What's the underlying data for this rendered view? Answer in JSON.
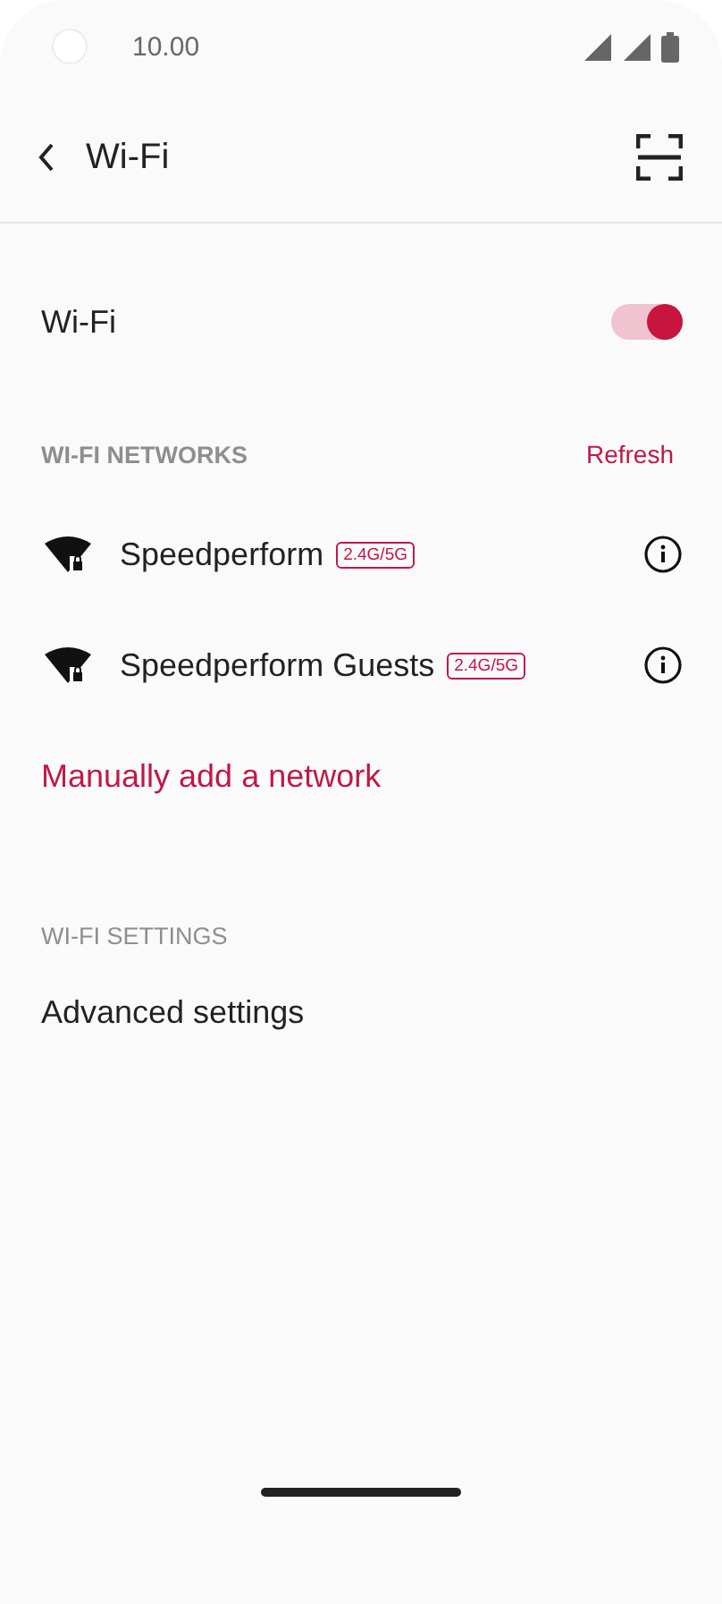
{
  "status_bar": {
    "time": "10.00"
  },
  "header": {
    "title": "Wi-Fi"
  },
  "wifi_toggle": {
    "label": "Wi-Fi",
    "on": true
  },
  "networks_section": {
    "title": "WI-FI NETWORKS",
    "action": "Refresh"
  },
  "networks": [
    {
      "name": "Speedperform",
      "band": "2.4G/5G",
      "secured": true
    },
    {
      "name": "Speedperform Guests",
      "band": "2.4G/5G",
      "secured": true
    }
  ],
  "add_network": "Manually add a network",
  "settings_section": {
    "title": "WI-FI SETTINGS"
  },
  "settings_items": [
    "Advanced settings"
  ]
}
